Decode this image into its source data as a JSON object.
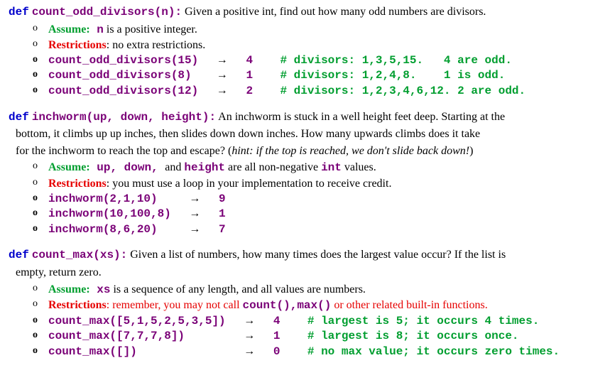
{
  "func1": {
    "def": "def",
    "name": "count_odd_divisors",
    "params": "(n):",
    "desc": " Given a positive int, find out how many odd numbers are divisors.",
    "assume_label": "Assume:",
    "assume_code": " n",
    "assume_rest": " is a positive integer.",
    "restrict_label": "Restrictions",
    "restrict_text": ": no extra restrictions.",
    "ex1_call": "count_odd_divisors(15)",
    "ex1_arrow": "   →   ",
    "ex1_result": "4",
    "ex1_comment": "    # divisors: 1,3,5,15.   4 are odd.",
    "ex2_call": "count_odd_divisors(8)",
    "ex2_arrow": "    →   ",
    "ex2_result": "1",
    "ex2_comment": "    # divisors: 1,2,4,8.    1 is odd.",
    "ex3_call": "count_odd_divisors(12)",
    "ex3_arrow": "   →   ",
    "ex3_result": "2",
    "ex3_comment": "    # divisors: 1,2,3,4,6,12. 2 are odd."
  },
  "func2": {
    "def": "def",
    "name": "inchworm",
    "params": "(up, down, height):",
    "desc1": " An inchworm is stuck in a well height feet deep. Starting at the",
    "desc2": "bottom, it climbs up up inches, then slides down down inches. How many upwards climbs does it take",
    "desc3": "for the inchworm to reach the top and escape? (",
    "hint": "hint: if the top is reached, we don't slide back down!",
    "desc3_end": ")",
    "assume_label": "Assume:",
    "assume_code": " up, down, ",
    "assume_mid": " and ",
    "assume_code2": "height",
    "assume_rest": " are all non-negative ",
    "assume_code3": "int",
    "assume_rest2": " values.",
    "restrict_label": "Restrictions",
    "restrict_text": ": you must use a loop in your implementation to receive credit.",
    "ex1_call": "inchworm(2,1,10)",
    "ex1_arrow": "     →   ",
    "ex1_result": "9",
    "ex2_call": "inchworm(10,100,8)",
    "ex2_arrow": "   →   ",
    "ex2_result": "1",
    "ex3_call": "inchworm(8,6,20)",
    "ex3_arrow": "     →   ",
    "ex3_result": "7"
  },
  "func3": {
    "def": "def",
    "name": "count_max",
    "params": "(xs):",
    "desc1": " Given a list of numbers, how many times does the largest value occur? If the list is",
    "desc2": "empty, return zero.",
    "assume_label": "Assume:",
    "assume_code": " xs",
    "assume_rest": " is a sequence of any length, and all values are numbers.",
    "restrict_label": "Restrictions",
    "restrict_text1": ": remember, you may not call ",
    "restrict_code": "count(),max()",
    "restrict_text2": " or other related built-in functions.",
    "ex1_call": "count_max([5,1,5,2,5,3,5])",
    "ex1_arrow": "   →   ",
    "ex1_result": "4",
    "ex1_comment": "    # largest is 5; it occurs 4 times.",
    "ex2_call": "count_max([7,7,7,8])",
    "ex2_arrow": "         →   ",
    "ex2_result": "1",
    "ex2_comment": "    # largest is 8; it occurs once.",
    "ex3_call": "count_max([])",
    "ex3_arrow": "                →   ",
    "ex3_result": "0",
    "ex3_comment": "    # no max value; it occurs zero times."
  }
}
